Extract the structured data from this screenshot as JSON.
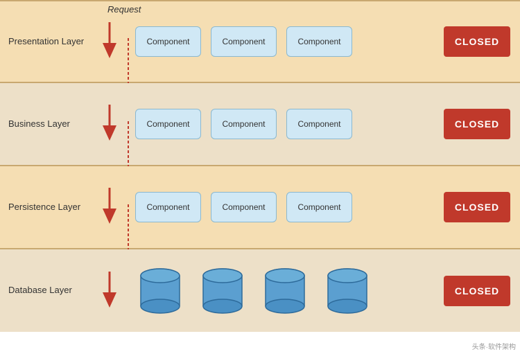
{
  "request_label": "Request",
  "layers": [
    {
      "id": "presentation",
      "name": "Presentation Layer",
      "components": [
        "Component",
        "Component",
        "Component"
      ],
      "closed_label": "CLOSED",
      "type": "components"
    },
    {
      "id": "business",
      "name": "Business Layer",
      "components": [
        "Component",
        "Component",
        "Component"
      ],
      "closed_label": "CLOSED",
      "type": "components"
    },
    {
      "id": "persistence",
      "name": "Persistence Layer",
      "components": [
        "Component",
        "Component",
        "Component"
      ],
      "closed_label": "CLOSED",
      "type": "components"
    },
    {
      "id": "database",
      "name": "Database Layer",
      "components": [
        "db",
        "db",
        "db",
        "db"
      ],
      "closed_label": "CLOSED",
      "type": "database"
    }
  ],
  "colors": {
    "closed_bg": "#c0392b",
    "component_bg": "#d0e8f5",
    "arrow_color": "#c0392b",
    "layer_odd": "#f5deb3",
    "layer_even": "#ede0c8"
  }
}
